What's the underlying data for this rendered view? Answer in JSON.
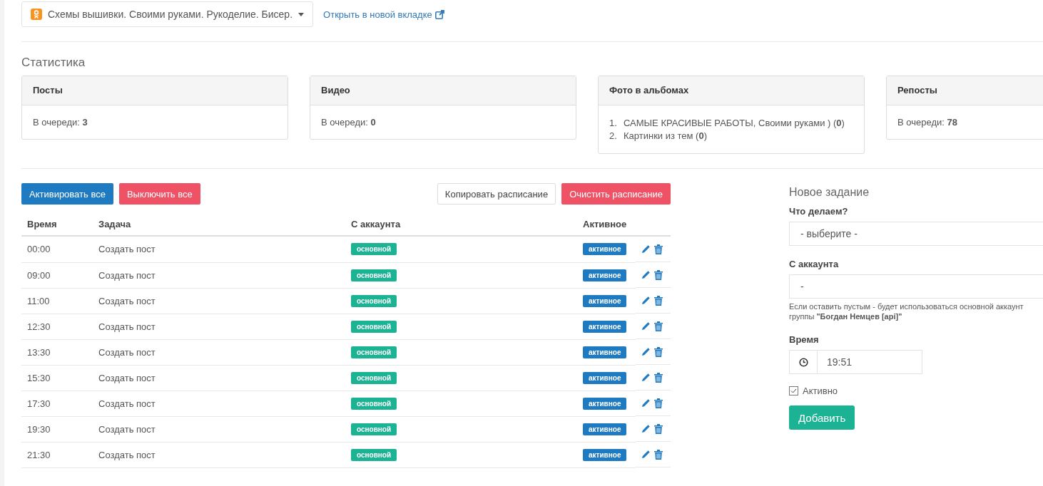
{
  "group_select": {
    "label": "Схемы вышивки. Своими руками. Рукоделие. Бисер."
  },
  "open_link": "Открыть в новой вкладке",
  "stats_title": "Статистика",
  "stats": [
    {
      "kind": "text",
      "title": "Посты",
      "text": "В очереди: **3**"
    },
    {
      "kind": "text",
      "title": "Видео",
      "text": "В очереди: **0**"
    },
    {
      "kind": "list",
      "title": "Фото в альбомах",
      "items": [
        {
          "marker": "1.",
          "text": "САМЫЕ КРАСИВЫЕ РАБОТЫ, Своими руками ) (**0**)"
        },
        {
          "marker": "2.",
          "text": "Картинки из тем (**0**)"
        }
      ]
    },
    {
      "kind": "text",
      "title": "Репосты",
      "text": "В очереди: **78**"
    }
  ],
  "buttons": {
    "activate_all": "Активировать все",
    "disable_all": "Выключить все",
    "copy_schedule": "Копировать расписание",
    "clear_schedule": "Очистить расписание"
  },
  "table": {
    "columns": [
      "Время",
      "Задача",
      "С аккаунта",
      "Активное"
    ],
    "rows": [
      {
        "time": "00:00",
        "task": "Создать пост",
        "account": "основной",
        "active": "активное"
      },
      {
        "time": "09:00",
        "task": "Создать пост",
        "account": "основной",
        "active": "активное"
      },
      {
        "time": "11:00",
        "task": "Создать пост",
        "account": "основной",
        "active": "активное"
      },
      {
        "time": "12:30",
        "task": "Создать пост",
        "account": "основной",
        "active": "активное"
      },
      {
        "time": "13:30",
        "task": "Создать пост",
        "account": "основной",
        "active": "активное"
      },
      {
        "time": "15:30",
        "task": "Создать пост",
        "account": "основной",
        "active": "активное"
      },
      {
        "time": "17:30",
        "task": "Создать пост",
        "account": "основной",
        "active": "активное"
      },
      {
        "time": "19:30",
        "task": "Создать пост",
        "account": "основной",
        "active": "активное"
      },
      {
        "time": "21:30",
        "task": "Создать пост",
        "account": "основной",
        "active": "активное"
      }
    ]
  },
  "new_task": {
    "title": "Новое задание",
    "what_label": "Что делаем?",
    "what_value": "- выберите -",
    "account_label": "С аккаунта",
    "account_value": "-",
    "hint": "Если оставить пустым - будет использоваться основной аккаунт группы **\"Богдан Немцев [api]\"**",
    "time_label": "Время",
    "time_value": "19:51",
    "active_label": "Активно",
    "active_checked": true,
    "submit": "Добавить"
  }
}
